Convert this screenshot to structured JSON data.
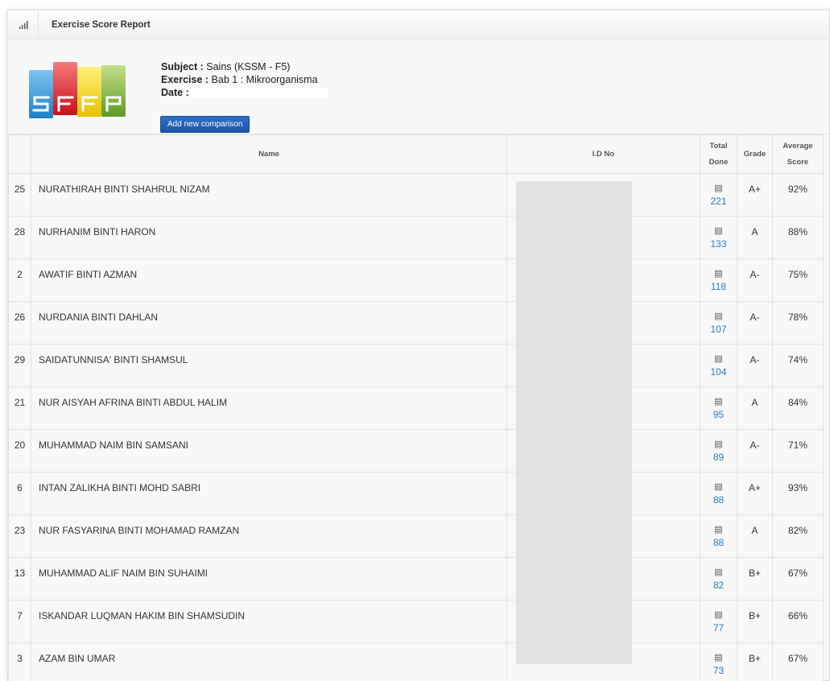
{
  "panel": {
    "title": "Exercise Score Report",
    "header_icon": "bar-chart-icon"
  },
  "info": {
    "logo_text": "SFFP",
    "subject_label": "Subject :",
    "subject_value": " Sains (KSSM - F5)",
    "exercise_label": "Exercise :",
    "exercise_value": " Bab 1 : Mikroorganisma",
    "date_label": "Date :",
    "add_button": "Add new comparison"
  },
  "table": {
    "headers": {
      "name": "Name",
      "id": "I.D No",
      "total_1": "Total",
      "total_2": "Done",
      "grade": "Grade",
      "avg_1": "Average",
      "avg_2": "Score"
    },
    "rows": [
      {
        "num": "25",
        "name": "NURATHIRAH BINTI SHAHRUL NIZAM",
        "total": "221",
        "grade": "A+",
        "avg": "92%"
      },
      {
        "num": "28",
        "name": "NURHANIM BINTI HARON",
        "total": "133",
        "grade": "A",
        "avg": "88%"
      },
      {
        "num": "2",
        "name": "AWATIF BINTI AZMAN",
        "total": "118",
        "grade": "A-",
        "avg": "75%"
      },
      {
        "num": "26",
        "name": "NURDANIA BINTI DAHLAN",
        "total": "107",
        "grade": "A-",
        "avg": "78%"
      },
      {
        "num": "29",
        "name": "SAIDATUNNISA' BINTI SHAMSUL",
        "total": "104",
        "grade": "A-",
        "avg": "74%"
      },
      {
        "num": "21",
        "name": "NUR AISYAH AFRINA BINTI ABDUL HALIM",
        "total": "95",
        "grade": "A",
        "avg": "84%"
      },
      {
        "num": "20",
        "name": "MUHAMMAD NAIM BIN SAMSANI",
        "total": "89",
        "grade": "A-",
        "avg": "71%"
      },
      {
        "num": "6",
        "name": "INTAN ZALIKHA BINTI MOHD SABRI",
        "total": "88",
        "grade": "A+",
        "avg": "93%"
      },
      {
        "num": "23",
        "name": "NUR FASYARINA BINTI MOHAMAD RAMZAN",
        "total": "88",
        "grade": "A",
        "avg": "82%"
      },
      {
        "num": "13",
        "name": "MUHAMMAD ALIF NAIM BIN SUHAIMI",
        "total": "82",
        "grade": "B+",
        "avg": "67%"
      },
      {
        "num": "7",
        "name": "ISKANDAR LUQMAN HAKIM BIN SHAMSUDIN",
        "total": "77",
        "grade": "B+",
        "avg": "66%"
      },
      {
        "num": "3",
        "name": "AZAM BIN UMAR",
        "total": "73",
        "grade": "B+",
        "avg": "67%"
      }
    ]
  },
  "colors": {
    "accent_button": "#1d56a8",
    "link_blue": "#2a7bc8",
    "logo_blue": "#2a8fd6",
    "logo_red": "#e0202a",
    "logo_yellow": "#f2d000",
    "logo_green": "#7bb23a"
  }
}
